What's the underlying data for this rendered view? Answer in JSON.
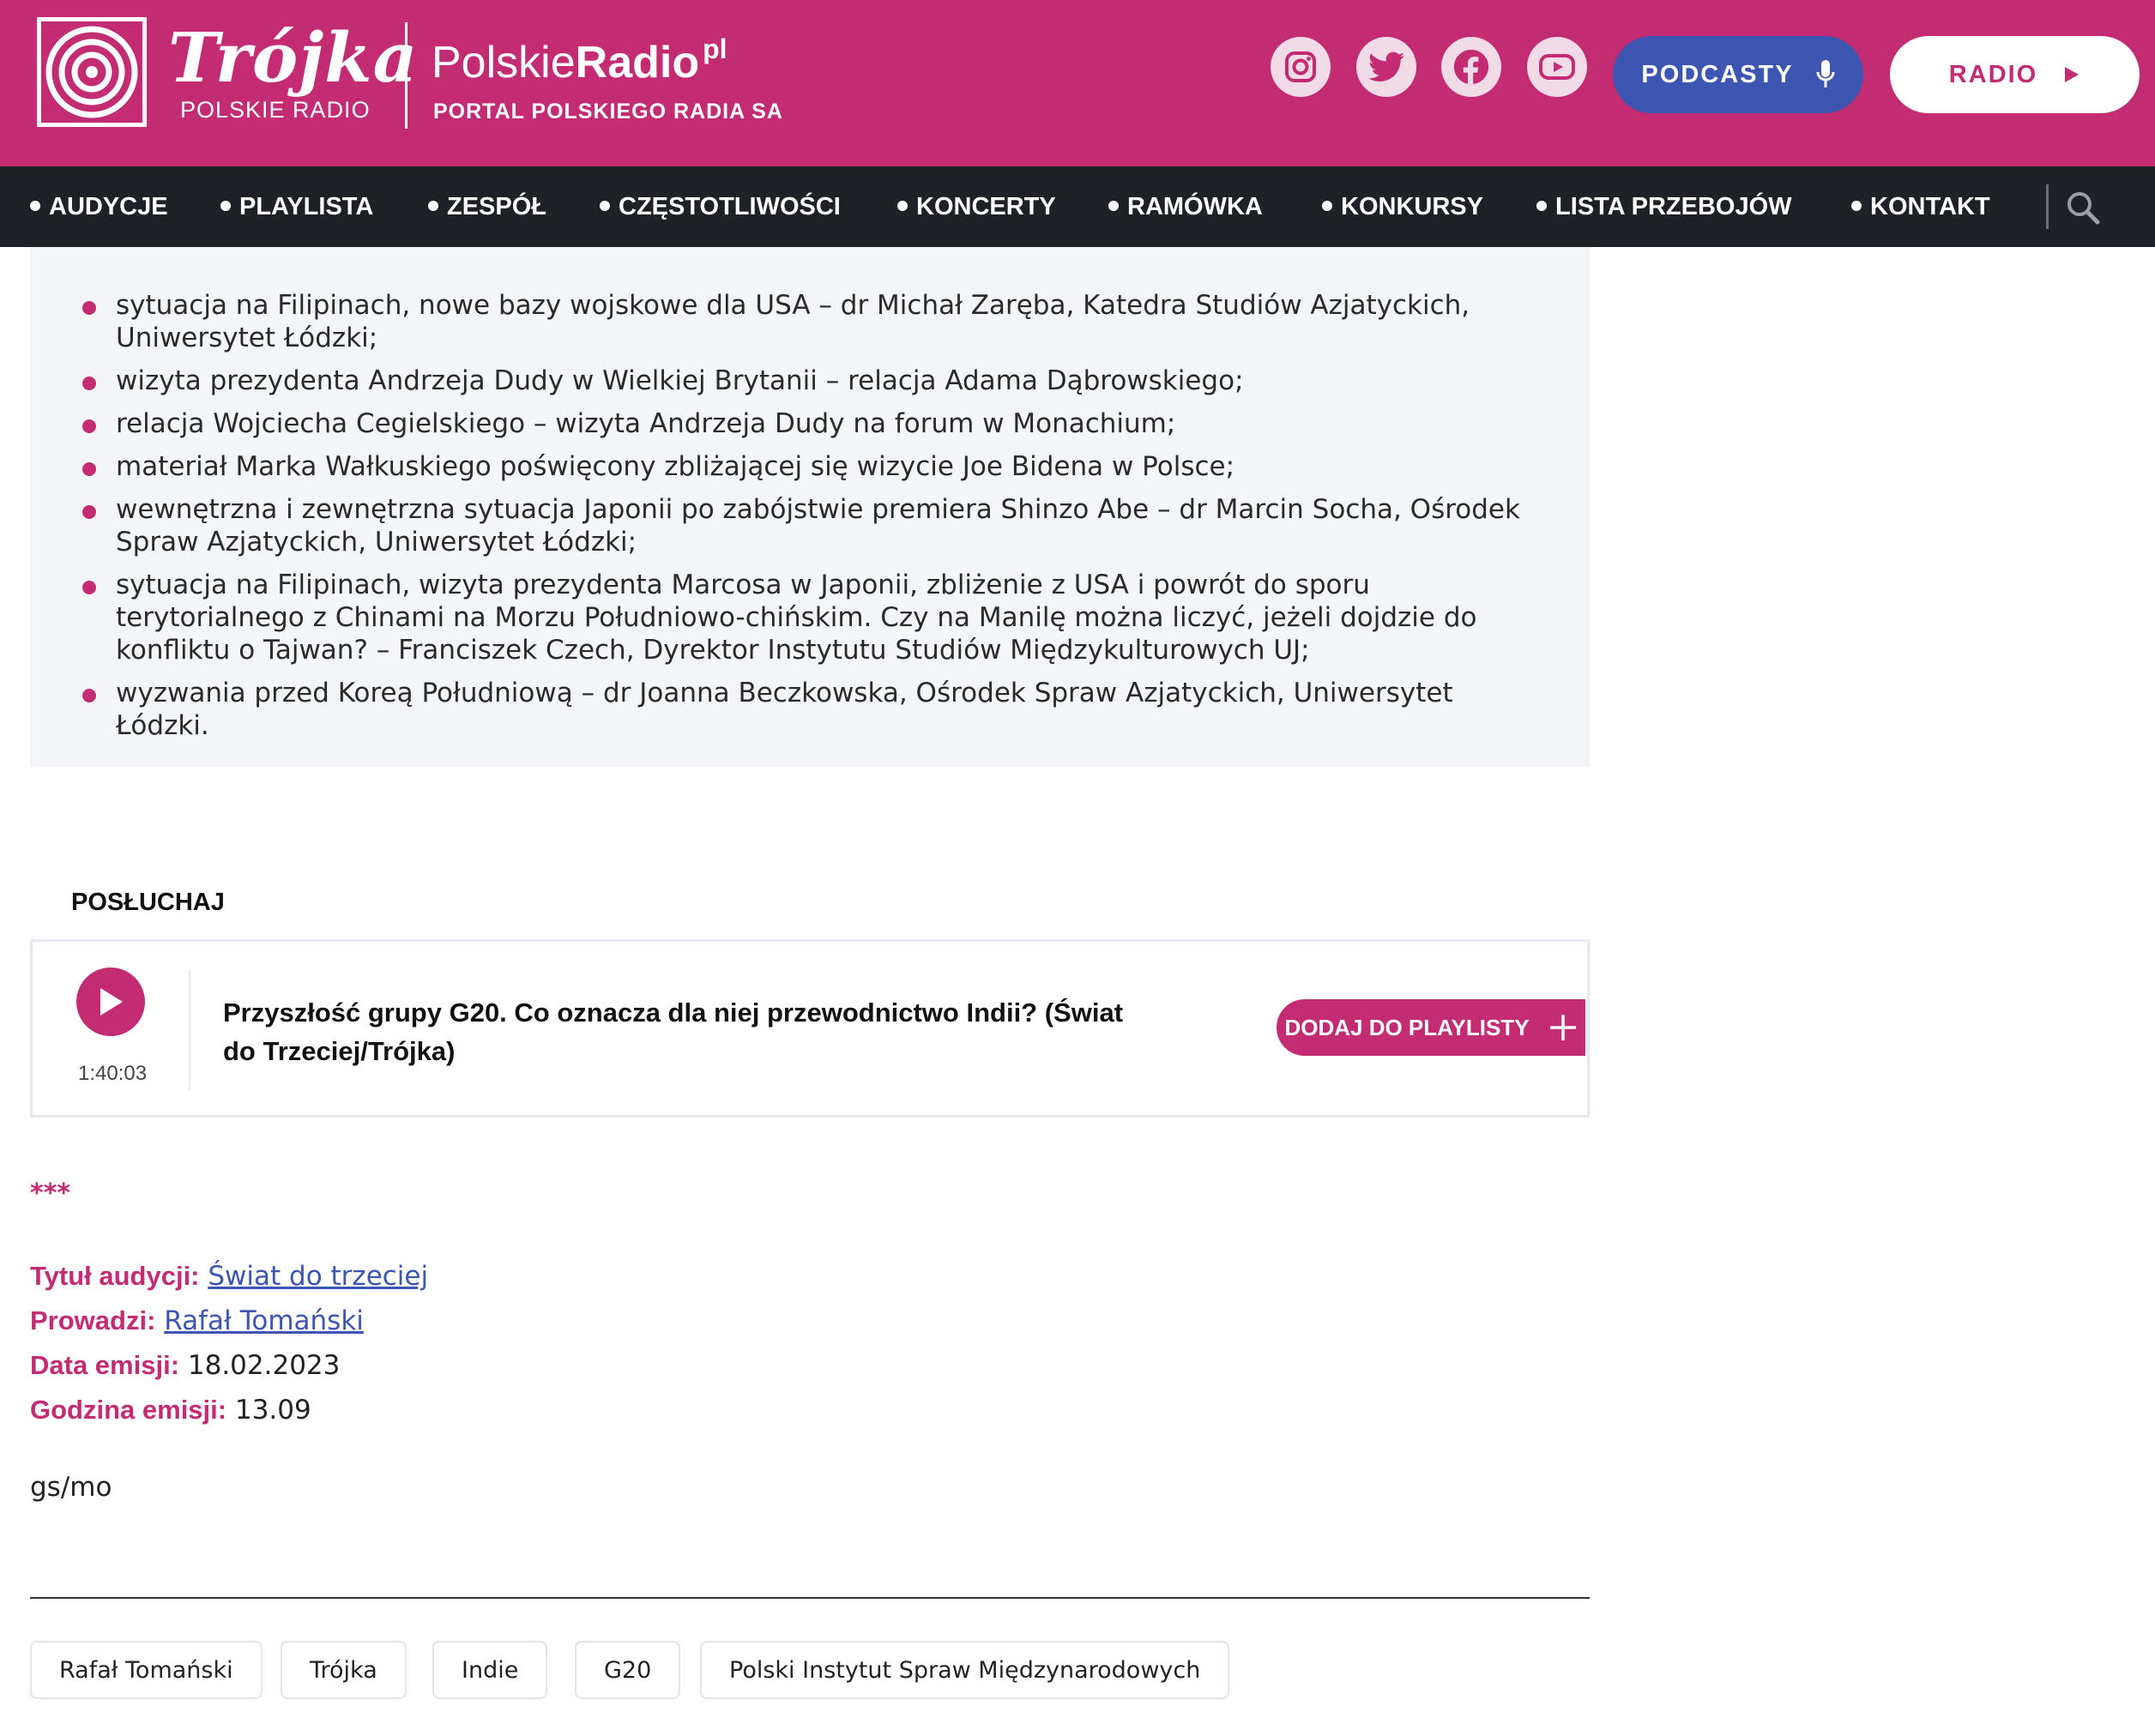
{
  "header": {
    "station_name": "Trójka",
    "station_sub": "POLSKIE RADIO",
    "brand_left": "Polskie",
    "brand_right": "Radio",
    "brand_suffix": "pl",
    "brand_sub": "PORTAL POLSKIEGO RADIA SA",
    "social_icons": [
      "instagram-icon",
      "twitter-icon",
      "facebook-icon",
      "youtube-icon"
    ],
    "podcasty_label": "PODCASTY",
    "radio_label": "RADIO"
  },
  "nav": {
    "items": [
      "AUDYCJE",
      "PLAYLISTA",
      "ZESPÓŁ",
      "CZĘSTOTLIWOŚCI",
      "KONCERTY",
      "RAMÓWKA",
      "KONKURSY",
      "LISTA PRZEBOJÓW",
      "KONTAKT"
    ]
  },
  "topics": [
    "sytuacja na Filipinach, nowe bazy wojskowe dla USA – dr Michał Zaręba, Katedra Studiów Azjatyckich, Uniwersytet Łódzki;",
    "wizyta prezydenta Andrzeja Dudy w Wielkiej Brytanii – relacja Adama Dąbrowskiego;",
    "relacja Wojciecha Cegielskiego – wizyta Andrzeja Dudy na forum w Monachium;",
    "materiał Marka Wałkuskiego poświęcony zbliżającej się wizycie Joe Bidena w Polsce;",
    "wewnętrzna i zewnętrzna sytuacja Japonii po zabójstwie premiera Shinzo Abe – dr Marcin Socha, Ośrodek Spraw Azjatyckich, Uniwersytet Łódzki;",
    "sytuacja na Filipinach, wizyta prezydenta Marcosa w Japonii, zbliżenie z USA i powrót do sporu terytorialnego z Chinami na Morzu Południowo-chińskim. Czy na Manilę można liczyć, jeżeli dojdzie do konfliktu o Tajwan?  –  Franciszek Czech, Dyrektor Instytutu Studiów Międzykulturowych UJ;",
    "wyzwania przed Koreą Południową – dr Joanna Beczkowska, Ośrodek Spraw Azjatyckich, Uniwersytet Łódzki."
  ],
  "listen": {
    "heading": "POSŁUCHAJ",
    "duration": "1:40:03",
    "title": "Przyszłość grupy G20. Co oznacza dla niej przewodnictwo Indii? (Świat do Trzeciej/Trójka)",
    "add_label": "DODAJ DO PLAYLISTY"
  },
  "separator": "***",
  "details": {
    "title_label": "Tytuł audycji:",
    "title_value": "Świat do trzeciej",
    "host_label": "Prowadzi:",
    "host_value": "Rafał Tomański",
    "date_label": "Data emisji:",
    "date_value": "18.02.2023",
    "hour_label": "Godzina emisji:",
    "hour_value": "13.09"
  },
  "initials": "gs/mo",
  "tags": [
    "Rafał Tomański",
    "Trójka",
    "Indie",
    "G20",
    "Polski Instytut Spraw Międzynarodowych"
  ],
  "colors": {
    "brand": "#c32b72",
    "nav_bg": "#1e2125",
    "podcasty_bg": "#3d56b2",
    "link": "#3d56b2",
    "content_bg": "#f4f5f9"
  }
}
